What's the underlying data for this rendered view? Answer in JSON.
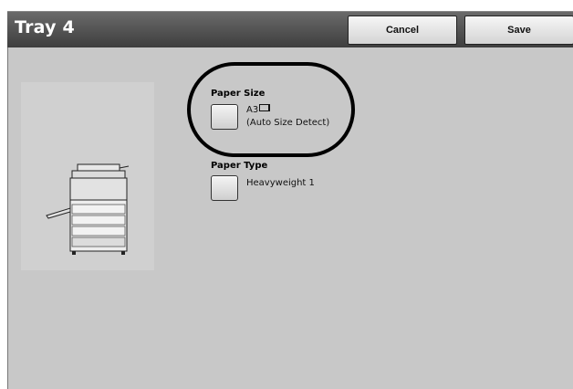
{
  "header": {
    "title": "Tray 4",
    "cancel_label": "Cancel",
    "save_label": "Save"
  },
  "paper_size": {
    "label": "Paper Size",
    "value": "A3",
    "orientation_icon": "short-edge-feed-icon",
    "detail": "(Auto Size Detect)"
  },
  "paper_type": {
    "label": "Paper Type",
    "value": "Heavyweight 1"
  },
  "colors": {
    "titlebar": "#4a4a4a",
    "panel": "#c8c8c8",
    "highlight": "#000000"
  }
}
